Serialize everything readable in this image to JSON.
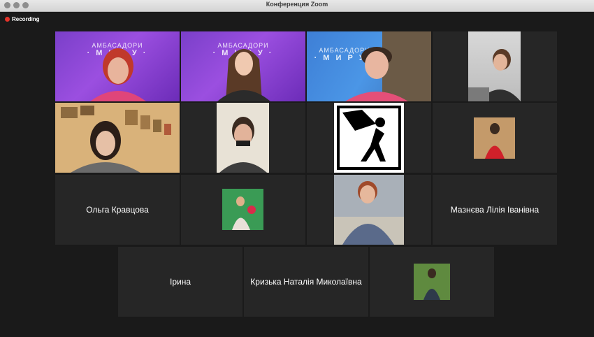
{
  "window": {
    "title": "Конференция Zoom"
  },
  "recording": {
    "label": "Recording"
  },
  "banner": {
    "line1": "АМБАСАДОРИ",
    "line2": "· М И Р У ·"
  },
  "participants": [
    {
      "name": "Ольга Кравцова"
    },
    {
      "name": "Мазнєва Лілія Іванівна"
    },
    {
      "name": "Ірина"
    },
    {
      "name": "Кризька Наталія Миколаївна"
    }
  ],
  "colors": {
    "recording": "#e5332a",
    "active_speaker": "#d9d97a",
    "tile_bg": "#262626",
    "background": "#1a1a1a"
  }
}
